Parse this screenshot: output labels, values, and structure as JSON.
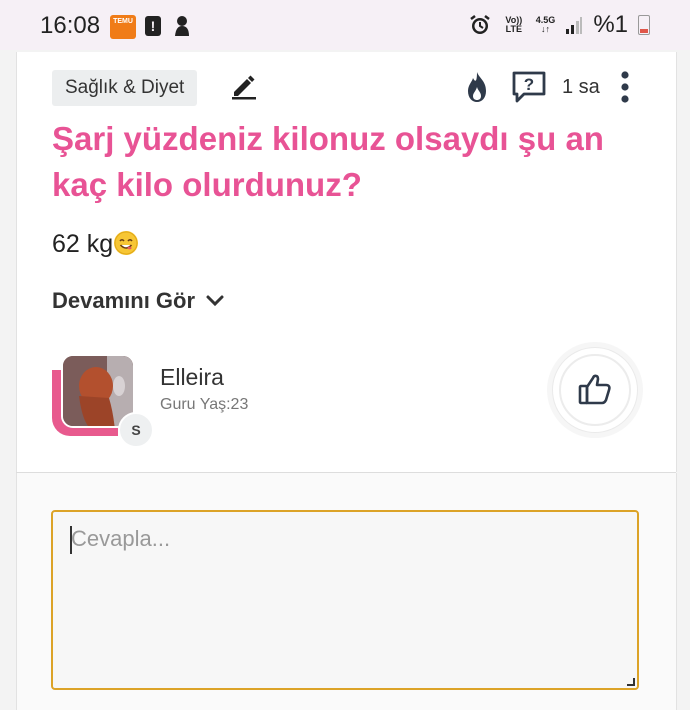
{
  "status_bar": {
    "time": "16:08",
    "temu_label": "TEMU",
    "network_volte": "Vo)) LTE",
    "network_type": "4.5G",
    "battery_text": "%1"
  },
  "post": {
    "category": "Sağlık & Diyet",
    "time_ago": "1 sa",
    "title": "Şarj yüzdeniz kilonuz olsaydı şu an kaç kilo olurdunuz?",
    "body": "62 kg",
    "body_emoji": "smiling-face-emoji",
    "see_more": "Devamını Gör"
  },
  "author": {
    "name": "Elleira",
    "meta": "Guru Yaş:23",
    "badge": "S"
  },
  "reply": {
    "placeholder": "Cevapla...",
    "value": ""
  },
  "colors": {
    "title": "#e85395",
    "avatar_frame": "#e85a8e",
    "reply_border": "#dca327",
    "status_bg": "#f6f0f6"
  },
  "icons": [
    "edit-pencil-icon",
    "fire-icon",
    "question-box-icon",
    "more-vertical-icon",
    "chevron-down-icon",
    "thumbs-up-icon"
  ]
}
